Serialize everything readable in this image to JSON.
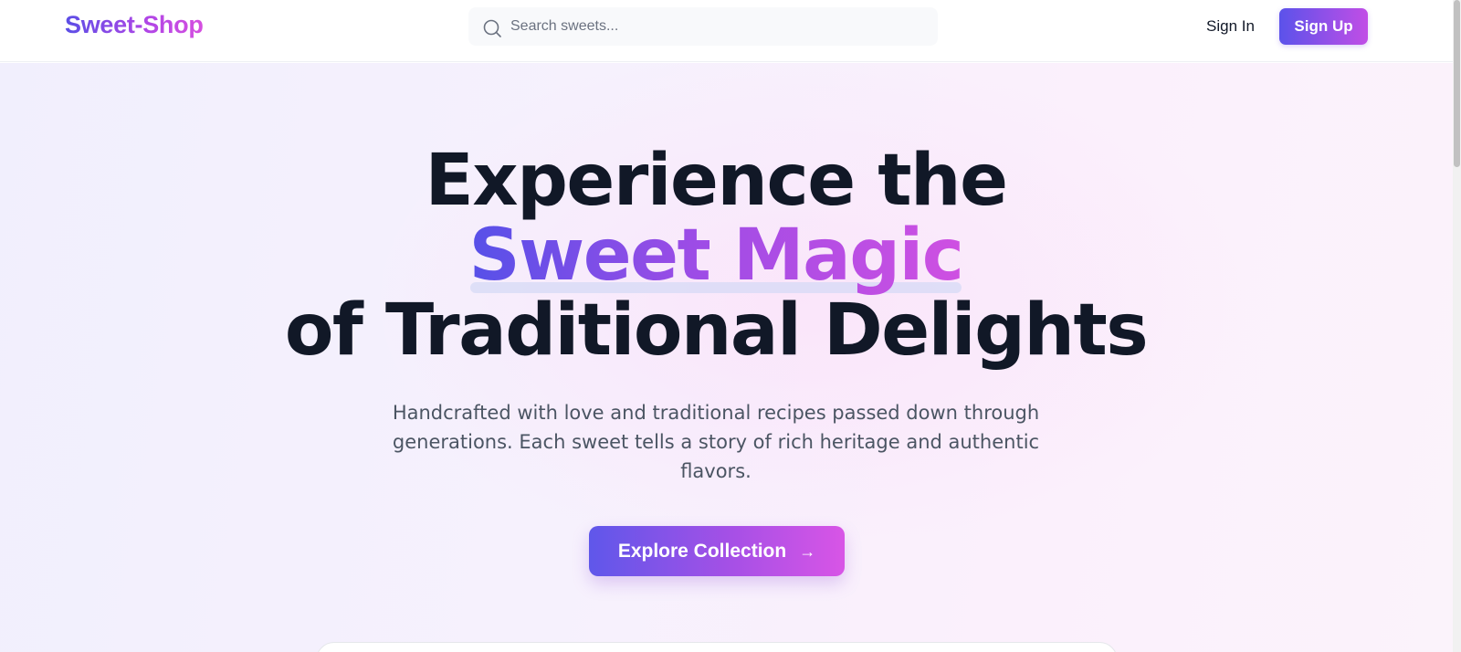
{
  "header": {
    "logo": "Sweet-Shop",
    "search": {
      "placeholder": "Search sweets...",
      "value": "",
      "icon": "search-icon"
    },
    "signin_label": "Sign In",
    "signup_label": "Sign Up"
  },
  "hero": {
    "title_line1": "Experience the",
    "title_accent": "Sweet Magic",
    "title_line3": "of Traditional Delights",
    "subtitle": "Handcrafted with love and traditional recipes passed down through generations. Each sweet tells a story of rich heritage and authentic flavors.",
    "cta_label": "Explore Collection",
    "cta_icon": "arrow-right-icon"
  },
  "colors": {
    "brand_start": "#5b4ee6",
    "brand_end": "#d64fe0",
    "title_text": "#111827",
    "subtitle_text": "#4b5563"
  }
}
